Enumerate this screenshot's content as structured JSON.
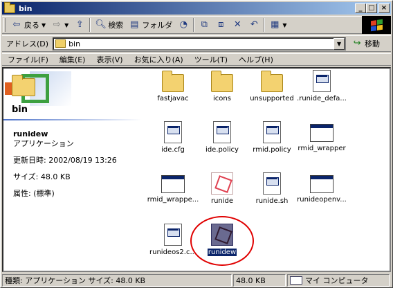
{
  "window": {
    "title": "bin"
  },
  "toolbar": {
    "back": "戻る",
    "search": "検索",
    "folders": "フォルダ"
  },
  "address": {
    "label": "アドレス(D)",
    "value": "bin",
    "go": "移動"
  },
  "menu": [
    "ファイル(F)",
    "編集(E)",
    "表示(V)",
    "お気に入り(A)",
    "ツール(T)",
    "ヘルプ(H)"
  ],
  "left_panel": {
    "folder_name": "bin",
    "selected_name": "runidew",
    "selected_type": "アプリケーション",
    "modified": "更新日時: 2002/08/19 13:26",
    "size": "サイズ: 48.0 KB",
    "attributes": "属性: (標準)"
  },
  "files": [
    {
      "name": "fastjavac",
      "icon": "folder-icon"
    },
    {
      "name": "icons",
      "icon": "folder-icon"
    },
    {
      "name": "unsupported",
      "icon": "folder-icon"
    },
    {
      "name": ".runide_defa...",
      "icon": "document-icon"
    },
    {
      "name": "ide.cfg",
      "icon": "document-icon"
    },
    {
      "name": "ide.policy",
      "icon": "document-icon"
    },
    {
      "name": "rmid.policy",
      "icon": "document-icon"
    },
    {
      "name": "rmid_wrapper",
      "icon": "window-icon"
    },
    {
      "name": "rmid_wrappe...",
      "icon": "window-icon"
    },
    {
      "name": "runide",
      "icon": "cube-icon"
    },
    {
      "name": "runide.sh",
      "icon": "document-icon"
    },
    {
      "name": "runideopenv...",
      "icon": "window-icon"
    },
    {
      "name": "runideos2.c...",
      "icon": "document-icon"
    },
    {
      "name": "runidew",
      "icon": "cube-icon",
      "selected": true
    }
  ],
  "status": {
    "type_size": "種類: アプリケーション サイズ: 48.0 KB",
    "size": "48.0 KB",
    "location": "マイ コンピュータ"
  },
  "colors": {
    "titlebar": "#0a246a",
    "highlight_circle": "#e00000"
  }
}
